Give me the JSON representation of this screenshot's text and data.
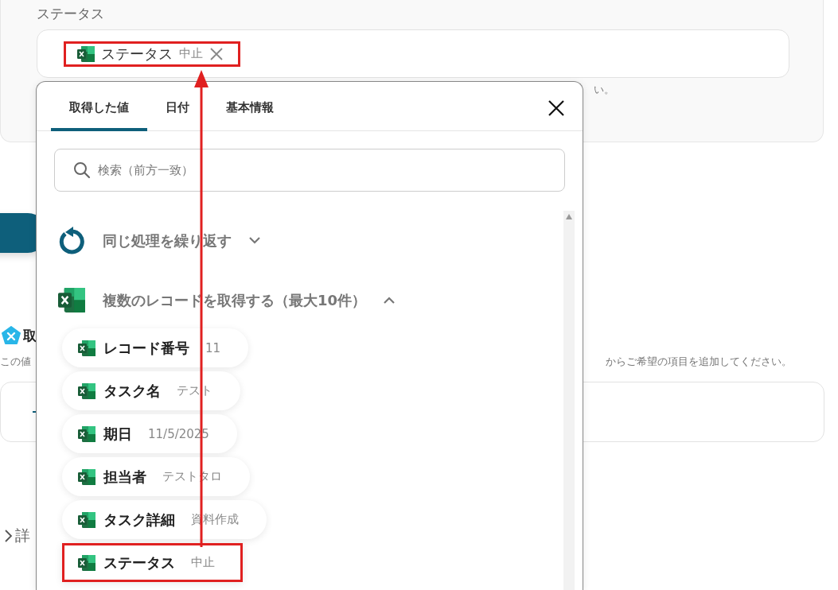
{
  "background": {
    "status_field": {
      "label": "ステータス",
      "chip": {
        "name": "ステータス",
        "value": "中止",
        "highlighted": true
      },
      "hint": "い。"
    },
    "section": {
      "heading": "取",
      "hint_left": "この値",
      "hint_right": "からご希望の項目を追加してください。"
    },
    "details": {
      "label": "詳",
      "expanded": false
    }
  },
  "picker": {
    "tabs": [
      {
        "label": "取得した値",
        "selected": true
      },
      {
        "label": "日付",
        "selected": false
      },
      {
        "label": "基本情報",
        "selected": false
      }
    ],
    "search": {
      "placeholder": "検索（前方一致）"
    },
    "groups": [
      {
        "kind": "loop",
        "label": "同じ処理を繰り返す",
        "expanded": false
      },
      {
        "kind": "excel",
        "label": "複数のレコードを取得する（最大10件）",
        "expanded": true,
        "items": [
          {
            "name": "レコード番号",
            "value": "11",
            "highlighted": false
          },
          {
            "name": "タスク名",
            "value": "テスト",
            "highlighted": false
          },
          {
            "name": "期日",
            "value": "11/5/2025",
            "highlighted": false
          },
          {
            "name": "担当者",
            "value": "テストタロ",
            "highlighted": false
          },
          {
            "name": "タスク詳細",
            "value": "資料作成",
            "highlighted": false
          },
          {
            "name": "ステータス",
            "value": "中止",
            "highlighted": true
          }
        ]
      }
    ]
  }
}
